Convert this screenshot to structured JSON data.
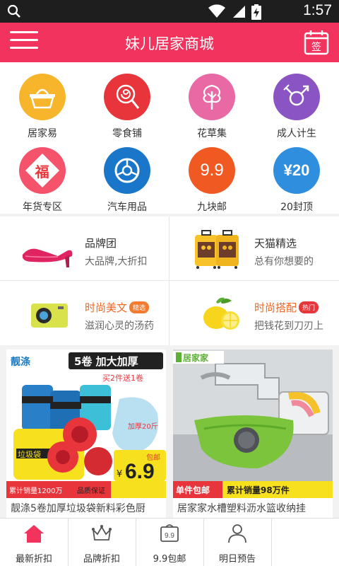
{
  "status_bar": {
    "time": "1:57"
  },
  "header": {
    "title": "妹儿居家商城",
    "sign_label": "签"
  },
  "categories": [
    {
      "label": "居家易",
      "icon": "basket-icon",
      "color": "#f7b52c"
    },
    {
      "label": "零食铺",
      "icon": "lollipop-icon",
      "color": "#e8353b"
    },
    {
      "label": "花草集",
      "icon": "tree-icon",
      "color": "#e969a5"
    },
    {
      "label": "成人计生",
      "icon": "gender-icon",
      "color": "#8a54c5"
    },
    {
      "label": "年货专区",
      "icon": "fu-icon",
      "color": "#f5536b",
      "glyph": "福"
    },
    {
      "label": "汽车用品",
      "icon": "wheel-icon",
      "color": "#1976c9"
    },
    {
      "label": "九块邮",
      "icon": "nine-nine-icon",
      "color": "#f05a22",
      "glyph": "9.9"
    },
    {
      "label": "20封顶",
      "icon": "twenty-yuan-icon",
      "color": "#2f8fde",
      "glyph": "¥20"
    }
  ],
  "promos": [
    {
      "title": "品牌团",
      "subtitle": "大品牌,大折扣"
    },
    {
      "title": "天猫精选",
      "subtitle": "总有你想要的"
    },
    {
      "title": "时尚美文",
      "badge": "精选",
      "subtitle": "滋润心灵的汤药"
    },
    {
      "title": "时尚搭配",
      "badge": "热门",
      "subtitle": "把钱花到刀刃上"
    }
  ],
  "products": [
    {
      "name": "靓涤5卷加厚垃圾袋新料彩色厨",
      "img_text": {
        "brand": "靓涤",
        "headline": "5卷 加大加厚",
        "offer": "买2件送1卷",
        "bag_label": "垃圾袋",
        "sticker": "加厚20斤",
        "sales": "累计销量1200万",
        "quality": "品质保证",
        "price": "6.9",
        "price_tag": "包邮",
        "currency": "¥"
      }
    },
    {
      "name": "居家家水槽塑料沥水篮收纳挂",
      "img_text": {
        "brand": "居家家",
        "shipping": "单件包邮",
        "sales": "累计销量98万件"
      }
    }
  ],
  "tabs": [
    {
      "label": "最新折扣",
      "icon": "house-icon"
    },
    {
      "label": "品牌折扣",
      "icon": "crown-icon"
    },
    {
      "label": "9.9包邮",
      "icon": "nine-nine-tag-icon",
      "glyph": "9.9"
    },
    {
      "label": "明日预告",
      "icon": "person-icon"
    }
  ],
  "colors": {
    "brand": "#f2335e",
    "accent_orange": "#f26522"
  }
}
